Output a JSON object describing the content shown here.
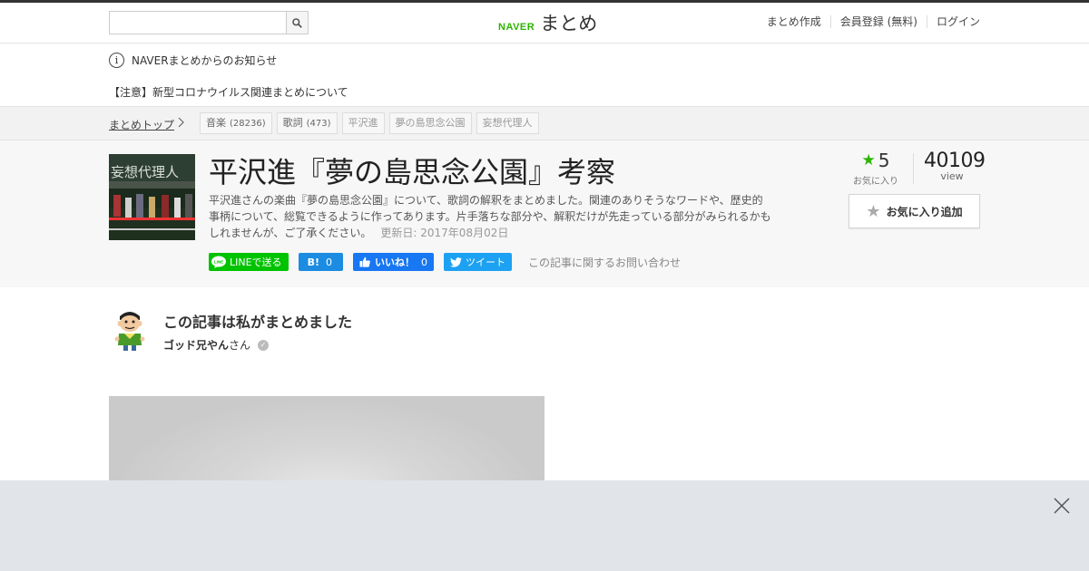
{
  "header": {
    "search_placeholder": "",
    "logo_naver": "NAVER",
    "logo_matome": "まとめ",
    "nav": [
      "まとめ作成",
      "会員登録 (無料)",
      "ログイン"
    ]
  },
  "notice": {
    "info_icon": "i",
    "title": "NAVERまとめからのお知らせ",
    "item": "【注意】新型コロナウイルス関連まとめについて"
  },
  "breadcrumb": {
    "top": "まとめトップ",
    "tags": [
      {
        "label": "音楽",
        "count": "(28236)"
      },
      {
        "label": "歌詞",
        "count": "(473)"
      },
      {
        "label": "平沢進",
        "count": ""
      },
      {
        "label": "夢の島思念公園",
        "count": ""
      },
      {
        "label": "妄想代理人",
        "count": ""
      }
    ]
  },
  "article": {
    "title": "平沢進『夢の島思念公園』考察",
    "description": "平沢進さんの楽曲『夢の島思念公園』について、歌詞の解釈をまとめました。関連のありそうなワードや、歴史的事柄について、総覧できるように作ってあります。片手落ちな部分や、解釈だけが先走っている部分がみられるかもしれませんが、ご了承ください。",
    "updated": "更新日: 2017年08月02日",
    "thumb_text": "妄想代理人",
    "favorites_count": "5",
    "favorites_label": "お気に入り",
    "views_count": "40109",
    "views_label": "view",
    "fav_button": "お気に入り追加",
    "share": {
      "line": "LINEで送る",
      "line_icon": "LINE",
      "hatena": "B!",
      "hatena_count": "0",
      "facebook": "いいね！",
      "facebook_count": "0",
      "twitter": "ツイート",
      "inquiry": "この記事に関するお問い合わせ"
    }
  },
  "author": {
    "heading": "この記事は私がまとめました",
    "name": "ゴッド兄やん",
    "suffix": "さん"
  },
  "colors": {
    "brand_green": "#2db400",
    "line_green": "#00c300",
    "facebook_blue": "#1877f2",
    "twitter_blue": "#1da1f2",
    "hatena_blue": "#1b8ce1"
  }
}
